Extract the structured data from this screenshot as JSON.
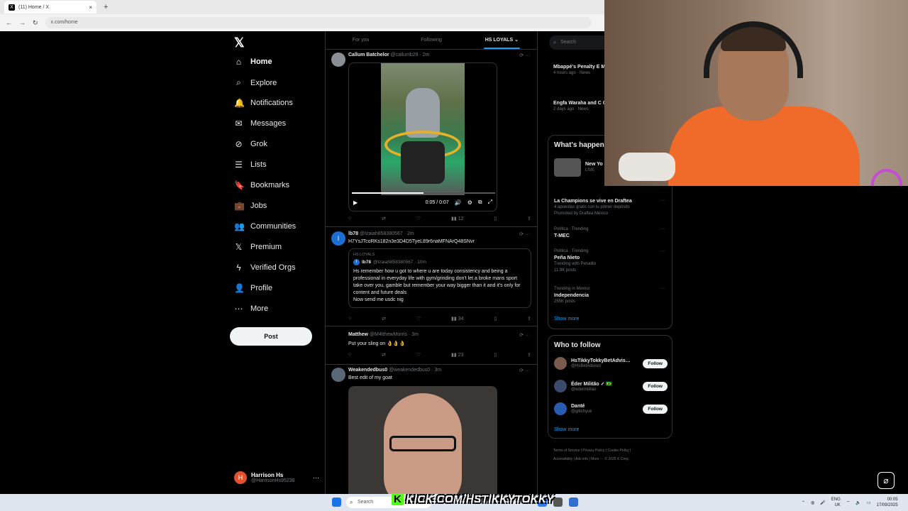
{
  "browser": {
    "tab_title": "(11) Home / X",
    "tab_close": "×",
    "new_tab": "+",
    "url": "x.com/home",
    "nav_back": "←",
    "nav_forward": "→",
    "nav_reload": "↻"
  },
  "sidebar": {
    "logo": "𝕏",
    "items": [
      {
        "label": "Home",
        "icon": "⌂"
      },
      {
        "label": "Explore",
        "icon": "⌕"
      },
      {
        "label": "Notifications",
        "icon": "🔔"
      },
      {
        "label": "Messages",
        "icon": "✉"
      },
      {
        "label": "Grok",
        "icon": "⊘"
      },
      {
        "label": "Lists",
        "icon": "☰"
      },
      {
        "label": "Bookmarks",
        "icon": "🔖"
      },
      {
        "label": "Jobs",
        "icon": "💼"
      },
      {
        "label": "Communities",
        "icon": "👥"
      },
      {
        "label": "Premium",
        "icon": "𝕏"
      },
      {
        "label": "Verified Orgs",
        "icon": "ϟ"
      },
      {
        "label": "Profile",
        "icon": "👤"
      },
      {
        "label": "More",
        "icon": "⋯"
      }
    ],
    "post_button": "Post",
    "account": {
      "name": "Harrison Hs",
      "handle": "@HarrisonHs95238",
      "initial": "H",
      "more": "···"
    }
  },
  "timeline": {
    "tabs": [
      "For you",
      "Following",
      "HS LOYALS ⌄"
    ],
    "tweets": [
      {
        "name": "Callum Batchelor",
        "handle": "@callumb29 · 2m",
        "video_time": "0:05 / 0:07",
        "views": "12"
      },
      {
        "name": "lb78",
        "handle": "@Izaiah858380567 · 2m",
        "text": "H7YsJTcoRKs182n3e3D4D5TyeL89r6naMFNArQ48SNvr",
        "quote_label": "HS LOYALS",
        "quote_name": "lb78",
        "quote_handle": "@Izaiah858380567 · 10m",
        "quote_avatar": "I",
        "quote_text": "Hs remember how u got to where u are today consistency and being a professional in everyday life with gym/grinding don't let a broke mans sport take over you, gamble but remember your way bigger than it and it's only for content and future deals",
        "quote_text2": "Now send me usdc nig",
        "avatar": "I",
        "views": "34"
      },
      {
        "name": "Matthew",
        "handle": "@M4tthewMorris · 3m",
        "text": "Put your sling on 👌👌👌",
        "views": "23"
      },
      {
        "name": "Weakendedbus0",
        "handle": "@weakendedbus0 · 3m",
        "text": "Best edit of my goat"
      }
    ],
    "action_icons": {
      "reply": "○",
      "retweet": "⇄",
      "like": "♡",
      "views": "▮▮",
      "bookmark": "▯",
      "share": "⇪"
    },
    "option_icons": "⟳  ···"
  },
  "right": {
    "search_placeholder": "Search",
    "search_icon": "⌕",
    "news": [
      {
        "title": "Mbappé's Penalty E Madrid's 2-1 UCL W",
        "meta": "4 hours ago · News"
      },
      {
        "title": "Engfa Waraha and C Captivate Paris in E",
        "meta": "2 days ago · News"
      }
    ],
    "happening_title": "What's happen",
    "live": {
      "title": "New Yo",
      "meta": "LIVE"
    },
    "trends": [
      {
        "context": "",
        "title": "La Champions se vive en Draftea",
        "sub": "4 apuestas gratis con tu primer depósito",
        "extra": "Promoted by Draftea México"
      },
      {
        "context": "Política · Trending",
        "title": "T-MEC",
        "sub": "",
        "extra": ""
      },
      {
        "context": "Política · Trending",
        "title": "Peña Nieto",
        "sub": "Trending with Penalito",
        "extra": "11.9K posts"
      },
      {
        "context": "Trending in Mexico",
        "title": "Independencia",
        "sub": "255K posts",
        "extra": ""
      }
    ],
    "show_more": "Show more",
    "who_title": "Who to follow",
    "who": [
      {
        "name": "HsTikkyTokkyBetAdvis…",
        "handle": "@HsBetAdvisor"
      },
      {
        "name": "Éder Militão ✓ 🇧🇷",
        "handle": "@edermilitao"
      },
      {
        "name": "Danté",
        "handle": "@glitchyuk"
      }
    ],
    "follow_label": "Follow",
    "footer1": "Terms of Service  |  Privacy Policy  |  Cookie Policy  |",
    "footer2": "Accessibility  |  Ads info  |  More ···  © 2025 X Corp."
  },
  "taskbar": {
    "search": "Search",
    "kick_k": "K",
    "kick_text": "KICK.COM/HSTIKKYTOKKY",
    "lang1": "ENG",
    "lang2": "UK",
    "time": "00:05",
    "date": "17/09/2025"
  },
  "colors": {
    "accent": "#1d9bf0",
    "background": "#000000",
    "kick_green": "#53fc18"
  }
}
